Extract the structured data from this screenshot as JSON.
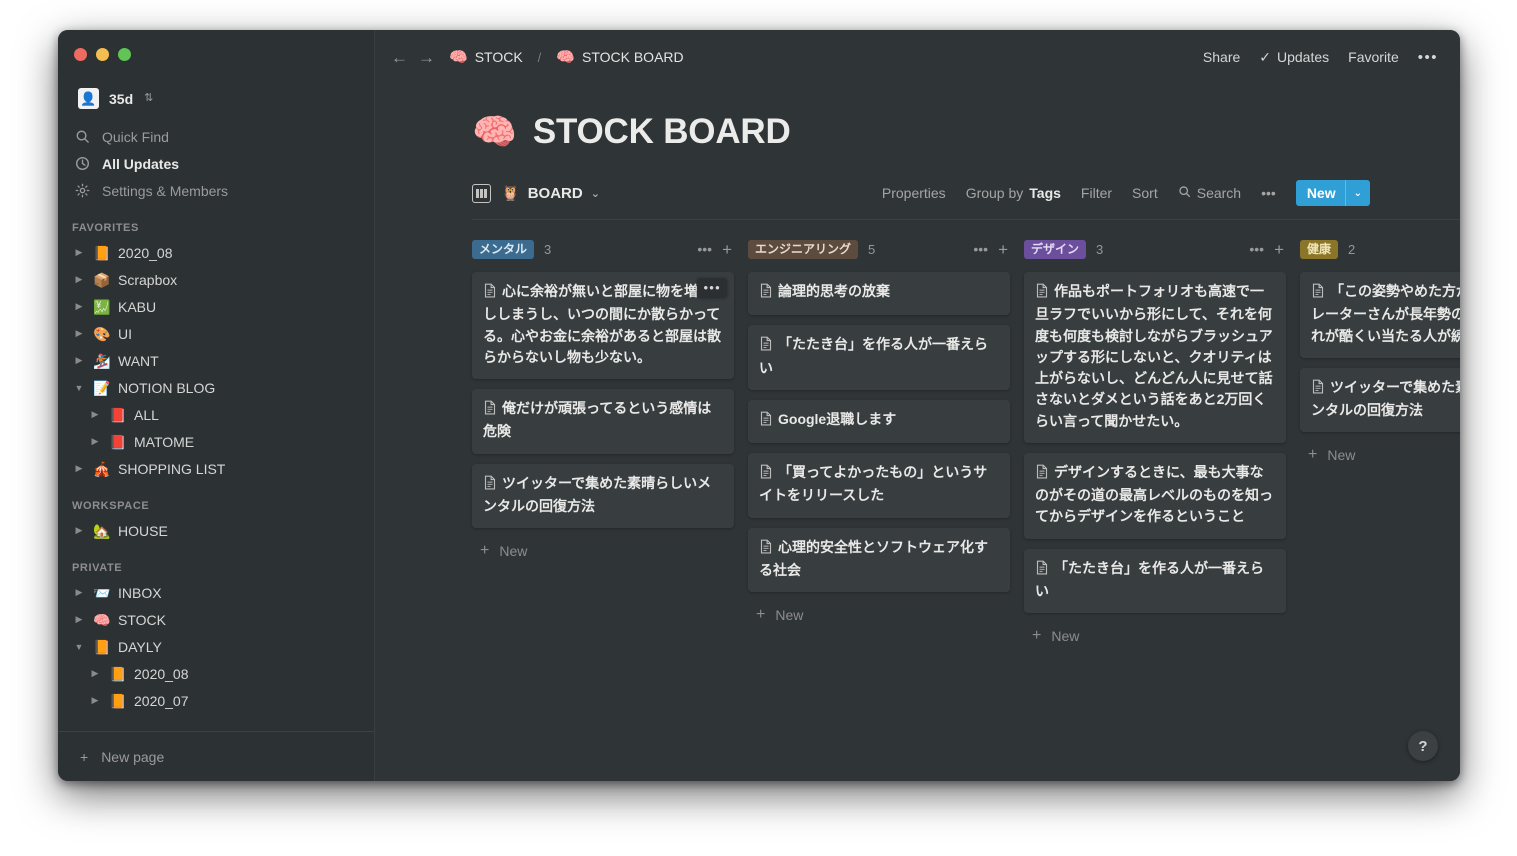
{
  "window": {
    "traffic_lights": [
      "close",
      "minimize",
      "zoom"
    ]
  },
  "sidebar": {
    "workspace": {
      "avatar_emoji": "👤",
      "name": "35d",
      "chevron": "⌃⌄"
    },
    "nav": [
      {
        "label": "Quick Find",
        "icon": "search-icon",
        "active": false
      },
      {
        "label": "All Updates",
        "icon": "clock-icon",
        "active": true
      },
      {
        "label": "Settings & Members",
        "icon": "gear-icon",
        "active": false
      }
    ],
    "sections": [
      {
        "label": "FAVORITES",
        "items": [
          {
            "emoji": "📙",
            "label": "2020_08",
            "expanded": false,
            "indent": false
          },
          {
            "emoji": "📦",
            "label": "Scrapbox",
            "expanded": false,
            "indent": false
          },
          {
            "emoji": "💹",
            "label": "KABU",
            "expanded": false,
            "indent": false
          },
          {
            "emoji": "🎨",
            "label": "UI",
            "expanded": false,
            "indent": false
          },
          {
            "emoji": "🏂",
            "label": "WANT",
            "expanded": false,
            "indent": false
          },
          {
            "emoji": "📝",
            "label": "NOTION BLOG",
            "expanded": true,
            "indent": false
          },
          {
            "emoji": "📕",
            "label": "ALL",
            "expanded": false,
            "indent": true
          },
          {
            "emoji": "📕",
            "label": "MATOME",
            "expanded": false,
            "indent": true
          },
          {
            "emoji": "🎪",
            "label": "SHOPPING LIST",
            "expanded": false,
            "indent": false
          }
        ]
      },
      {
        "label": "WORKSPACE",
        "items": [
          {
            "emoji": "🏡",
            "label": "HOUSE",
            "expanded": false,
            "indent": false
          }
        ]
      },
      {
        "label": "PRIVATE",
        "items": [
          {
            "emoji": "📨",
            "label": "INBOX",
            "expanded": false,
            "indent": false
          },
          {
            "emoji": "🧠",
            "label": "STOCK",
            "expanded": false,
            "indent": false
          },
          {
            "emoji": "📙",
            "label": "DAYLY",
            "expanded": true,
            "indent": false
          },
          {
            "emoji": "📙",
            "label": "2020_08",
            "expanded": false,
            "indent": true
          },
          {
            "emoji": "📙",
            "label": "2020_07",
            "expanded": false,
            "indent": true
          }
        ]
      }
    ],
    "new_page_label": "New page"
  },
  "topbar": {
    "back_arrow": "←",
    "forward_arrow": "→",
    "breadcrumbs": [
      {
        "emoji": "🧠",
        "label": "STOCK"
      },
      {
        "emoji": "🧠",
        "label": "STOCK BOARD"
      }
    ],
    "separator": "/",
    "actions": {
      "share": "Share",
      "updates": "Updates",
      "updates_check": "✓",
      "favorite": "Favorite",
      "more": "•••"
    }
  },
  "page": {
    "emoji": "🧠",
    "title": "STOCK BOARD"
  },
  "view_toolbar": {
    "view_emoji": "🦉",
    "view_name": "BOARD",
    "view_chevron": "⌄",
    "properties": "Properties",
    "group_by_prefix": "Group by",
    "group_by_value": "Tags",
    "filter": "Filter",
    "sort": "Sort",
    "search": "Search",
    "more": "•••",
    "new_label": "New",
    "new_chevron": "⌄",
    "new_color": "#2f9fd6"
  },
  "board": {
    "columns": [
      {
        "tag": "メンタル",
        "tag_bg": "#3b6b8f",
        "tag_fg": "#dce9f3",
        "count": "3",
        "new_label": "New",
        "cards": [
          {
            "text": "心に余裕が無いと部屋に物を増やししまうし、いつの間にか散らかってる。心やお金に余裕があると部屋は散らからないし物も少ない。",
            "menu": "•••"
          },
          {
            "text": "俺だけが頑張ってるという感情は危険",
            "menu": ""
          },
          {
            "text": "ツイッターで集めた素晴らしいメンタルの回復方法",
            "menu": ""
          }
        ]
      },
      {
        "tag": "エンジニアリング",
        "tag_bg": "#5e4b3f",
        "tag_fg": "#e6d9cd",
        "count": "5",
        "new_label": "New",
        "cards": [
          {
            "text": "論理的思考の放棄",
            "menu": ""
          },
          {
            "text": "「たたき台」を作る人が一番えらい",
            "menu": ""
          },
          {
            "text": "Google退職します",
            "menu": ""
          },
          {
            "text": "「買ってよかったもの」というサイトをリリースした",
            "menu": ""
          },
          {
            "text": "心理的安全性とソフトウェア化する社会",
            "menu": ""
          }
        ]
      },
      {
        "tag": "デザイン",
        "tag_bg": "#6b4f9c",
        "tag_fg": "#e4dbf2",
        "count": "3",
        "new_label": "New",
        "cards": [
          {
            "text": "作品もポートフォリオも高速で一旦ラフでいいから形にして、それを何度も何度も検討しながらブラッシュアップする形にしないと、クオリティは上がらないし、どんどん人に見せて話さないとダメという話をあと2万回くらい言って聞かせたい。",
            "menu": ""
          },
          {
            "text": "デザインするときに、最も大事なのがその道の最高レベルのものを知ってからデザインを作るということ",
            "menu": ""
          },
          {
            "text": "「たたき台」を作る人が一番えらい",
            "menu": ""
          }
        ]
      },
      {
        "tag": "健康",
        "tag_bg": "#8a7528",
        "tag_fg": "#efe5b8",
        "count": "2",
        "new_label": "New",
        "cards": [
          {
            "text": "「この姿勢やめた方がいいラストレーターさんが長年勢の影響で手の痺れが酷くい当たる人が続々",
            "menu": ""
          },
          {
            "text": "ツイッターで集めた素晴らしいメンタルの回復方法",
            "menu": ""
          }
        ]
      }
    ]
  },
  "help": {
    "label": "?"
  }
}
